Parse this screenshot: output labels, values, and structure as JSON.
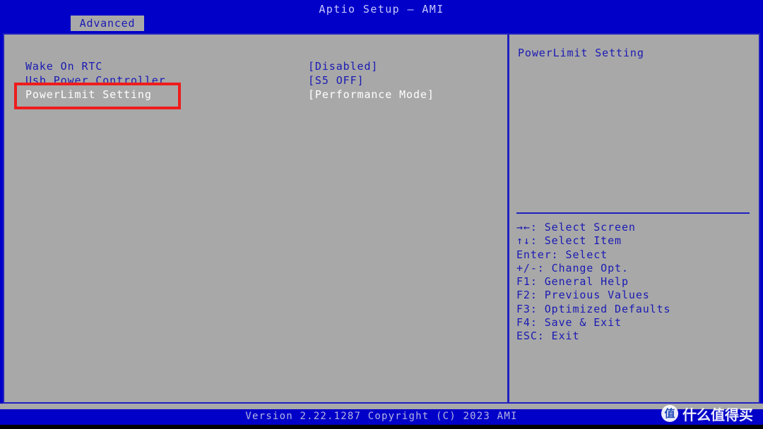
{
  "header": {
    "title": "Aptio Setup – AMI",
    "tab_label": "Advanced"
  },
  "settings": {
    "rows": [
      {
        "label": "Wake On RTC",
        "value": "[Disabled]",
        "selected": false
      },
      {
        "label": "Usb Power Controller",
        "value": "[S5 OFF]",
        "selected": false
      },
      {
        "label": "PowerLimit Setting",
        "value": "[Performance Mode]",
        "selected": true
      }
    ]
  },
  "help": {
    "title": "PowerLimit Setting",
    "keys": [
      "→←: Select Screen",
      "↑↓: Select Item",
      "Enter: Select",
      "+/-: Change Opt.",
      "F1: General Help",
      "F2: Previous Values",
      "F3: Optimized Defaults",
      "F4: Save & Exit",
      "ESC: Exit"
    ]
  },
  "footer": {
    "version_text": "Version 2.22.1287 Copyright (C) 2023 AMI"
  },
  "watermark": {
    "logo_char": "值",
    "text": "什么值得买"
  },
  "colors": {
    "screen_blue": "#0000c8",
    "panel_gray": "#a8a8a8",
    "text_blue": "#1a1ab4",
    "text_selected": "#ffffff",
    "annotation_red": "#ee1c1c",
    "title_text": "#c8c8ff"
  }
}
